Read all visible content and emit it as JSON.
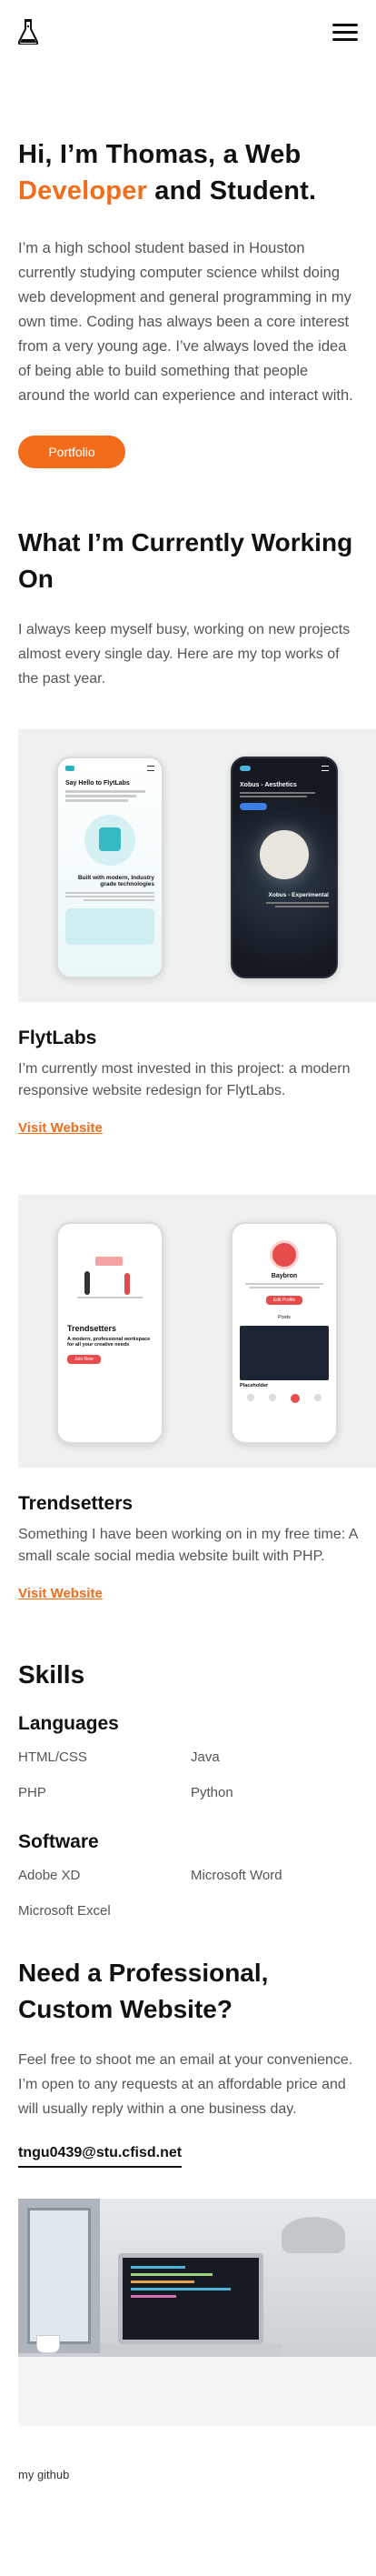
{
  "header": {
    "logo_icon": "flask-icon",
    "menu_icon": "hamburger-menu-icon"
  },
  "hero": {
    "title_prefix": "Hi, I’m Thomas, a Web ",
    "title_highlight": "Developer",
    "title_suffix": " and Student.",
    "intro": "I’m a high school student based in Houston currently studying computer science whilst doing web development and general programming in my own time. Coding has always been a core interest from a very young age. I’ve always loved the idea of being able to build something that people around the world can experience and interact with.",
    "button": "Portfolio"
  },
  "working": {
    "title": "What I’m Currently Working On",
    "intro": "I always keep myself busy, working on new projects almost every single day. Here are my top works of the past year."
  },
  "projects": [
    {
      "title": "FlytLabs",
      "description": "I’m currently most invested in this project: a modern responsive website redesign for FlytLabs.",
      "link": "Visit Website",
      "phone1": {
        "heading": "Say Hello to FlytLabs",
        "sub": "Built with modern, Industry grade technologies"
      },
      "phone2": {
        "heading": "Xobus - Aesthetics",
        "sub": "Xobus - Experimental"
      }
    },
    {
      "title": "Trendsetters",
      "description": "Something I have been working on in my free time: A small scale social media website built with PHP.",
      "link": "Visit Website",
      "phone1": {
        "heading": "Trendsetters",
        "sub": "A modern, professional workspace for all your creative needs",
        "button": "Join Now"
      },
      "phone2": {
        "name": "Baybron",
        "button": "Edit Profile",
        "posts": "Posts",
        "caption": "Placeholder"
      }
    }
  ],
  "skills": {
    "title": "Skills",
    "languages_title": "Languages",
    "languages": [
      "HTML/CSS",
      "Java",
      "PHP",
      "Python"
    ],
    "software_title": "Software",
    "software": [
      "Adobe XD",
      "Microsoft Word",
      "Microsoft Excel"
    ]
  },
  "contact": {
    "title": "Need a Professional, Custom Website?",
    "text": "Feel free to shoot me an email at your convenience. I’m open to any requests at an affordable price and will usually reply within a one business day.",
    "email": "tngu0439@stu.cfisd.net"
  },
  "footer": {
    "github": "my github"
  },
  "colors": {
    "accent": "#f26c1c"
  }
}
